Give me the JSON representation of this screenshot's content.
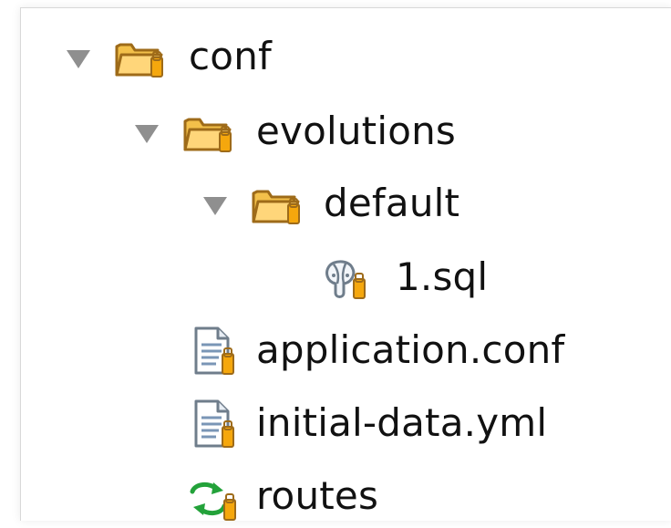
{
  "tree": {
    "items": [
      {
        "label": "conf",
        "icon": "folder-icon",
        "expanded": true,
        "level": 0
      },
      {
        "label": "evolutions",
        "icon": "folder-icon",
        "expanded": true,
        "level": 1
      },
      {
        "label": "default",
        "icon": "folder-icon",
        "expanded": true,
        "level": 2
      },
      {
        "label": "1.sql",
        "icon": "database-file-icon",
        "expanded": null,
        "level": 3
      },
      {
        "label": "application.conf",
        "icon": "text-file-icon",
        "expanded": null,
        "level": 1
      },
      {
        "label": "initial-data.yml",
        "icon": "text-file-icon",
        "expanded": null,
        "level": 1
      },
      {
        "label": "routes",
        "icon": "routes-file-icon",
        "expanded": null,
        "level": 1
      }
    ]
  },
  "colors": {
    "folder_fill": "#f3c04a",
    "folder_stroke": "#9e6b19",
    "twisty": "#8f8f8f",
    "text": "#111111",
    "badge_fill": "#f5a70d",
    "routes_green": "#23a23a"
  }
}
